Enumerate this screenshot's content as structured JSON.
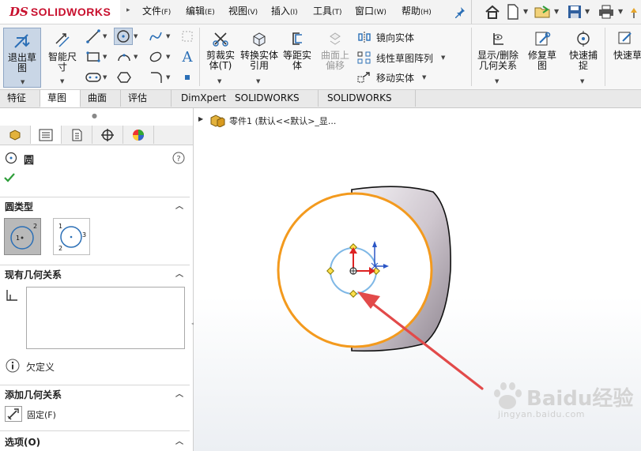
{
  "app": {
    "brand_prefix": "DS",
    "brand_name": "SOLIDWORKS"
  },
  "menu": [
    {
      "label": "文件",
      "key": "(F)"
    },
    {
      "label": "编辑",
      "key": "(E)"
    },
    {
      "label": "视图",
      "key": "(V)"
    },
    {
      "label": "插入",
      "key": "(I)"
    },
    {
      "label": "工具",
      "key": "(T)"
    },
    {
      "label": "窗口",
      "key": "(W)"
    },
    {
      "label": "帮助",
      "key": "(H)"
    }
  ],
  "toolbar_icons": [
    "pin-icon",
    "home-icon",
    "new-file-icon",
    "open-file-icon",
    "save-icon",
    "print-icon"
  ],
  "commands": {
    "exit_sketch": "退出草图",
    "smart_dim": "智能尺寸",
    "trim": "剪裁实体(T)",
    "convert": "转换实体引用",
    "offset": "等距实体",
    "surface_offset": "曲面上偏移",
    "mirror": "镜向实体",
    "linear_pattern": "线性草图阵列",
    "move": "移动实体",
    "display_relations": "显示/删除几何关系",
    "repair": "修复草图",
    "quick_snap": "快速捕捉",
    "quick_sketch": "快速草"
  },
  "tabs": [
    "特征",
    "草图",
    "曲面",
    "评估",
    "DimXpert",
    "SOLIDWORKS 插件",
    "SOLIDWORKS MBD"
  ],
  "active_tab": "草图",
  "feature_tree": {
    "part_label": "零件1 (默认<<默认>_显..."
  },
  "property_manager": {
    "title": "圆",
    "circle_type_header": "圆类型",
    "existing_relations_header": "现有几何关系",
    "status": "欠定义",
    "add_relations_header": "添加几何关系",
    "fixed_label": "固定(F)",
    "options_header": "选项(O)"
  },
  "colors": {
    "brand_red": "#c8102e",
    "edge_orange": "#f39a1e",
    "sketch_blue": "#7fb8e6",
    "arrow_red": "#e24a4a",
    "confirm_green": "#2e9e3a"
  },
  "watermark": {
    "brand": "Baidu经验",
    "url": "jingyan.baidu.com"
  }
}
